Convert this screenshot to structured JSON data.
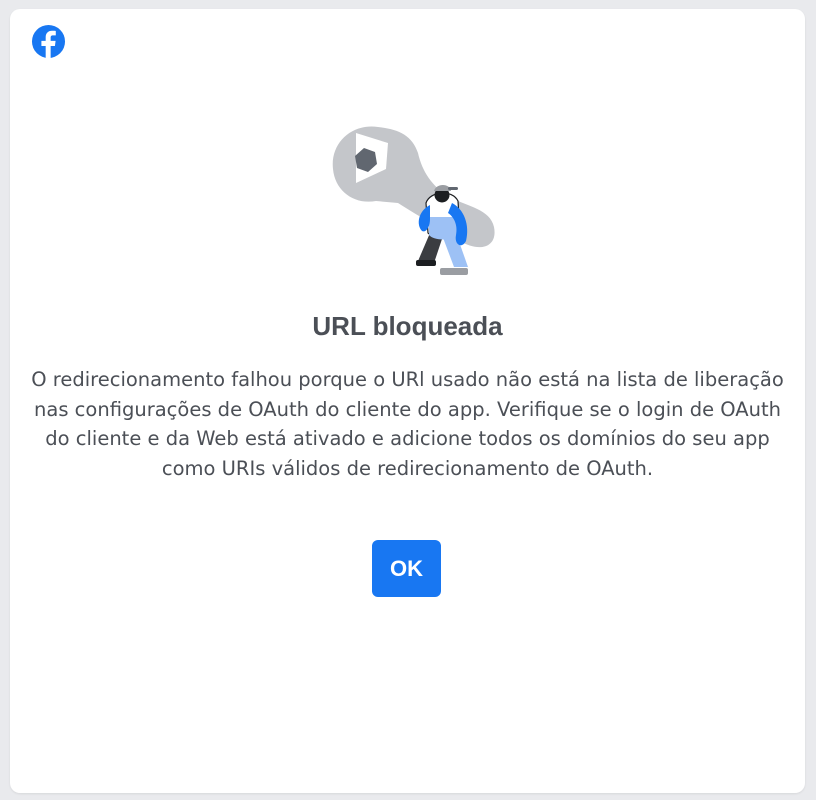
{
  "dialog": {
    "title": "URL bloqueada",
    "message": "O redirecionamento falhou porque o URl usado não está na lista de liberação nas configurações de OAuth do cliente do app. Verifique se o login de OAuth do cliente e da Web está ativado e adicione todos os domínios do seu app como URIs válidos de redirecionamento de OAuth.",
    "ok_label": "OK"
  },
  "logo": {
    "icon": "facebook-logo-icon",
    "color": "#1877f2"
  },
  "illustration": {
    "icon": "wrench-mechanic-illustration"
  },
  "colors": {
    "accent": "#1877f2",
    "text": "#4b4f56",
    "background": "#e9eaed",
    "card": "#ffffff"
  }
}
